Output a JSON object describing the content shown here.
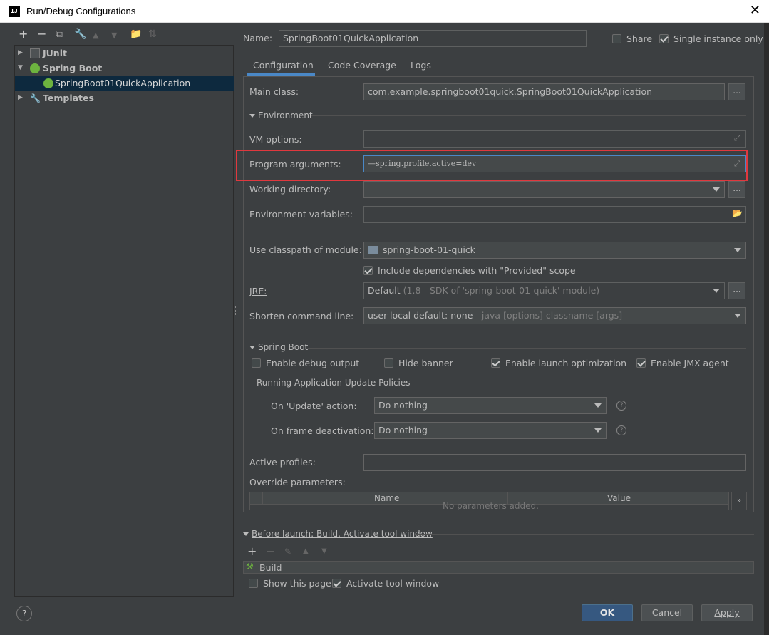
{
  "window": {
    "title": "Run/Debug Configurations",
    "logo": "IJ"
  },
  "tree": {
    "items": [
      {
        "label": "JUnit"
      },
      {
        "label": "Spring Boot"
      },
      {
        "label": "SpringBoot01QuickApplication"
      },
      {
        "label": "Templates"
      }
    ]
  },
  "header": {
    "name_label": "Name:",
    "name_value": "SpringBoot01QuickApplication",
    "share_label": "Share",
    "single_instance_label": "Single instance only"
  },
  "tabs": [
    {
      "label": "Configuration"
    },
    {
      "label": "Code Coverage"
    },
    {
      "label": "Logs"
    }
  ],
  "config": {
    "main_class_label": "Main class:",
    "main_class_value": "com.example.springboot01quick.SpringBoot01QuickApplication",
    "environment_label": "Environment",
    "vm_options_label": "VM options:",
    "program_args_label": "Program arguments:",
    "program_args_value": "—spring.profile.active=dev",
    "working_dir_label": "Working directory:",
    "env_vars_label": "Environment variables:",
    "classpath_label": "Use classpath of module:",
    "classpath_value": "spring-boot-01-quick",
    "include_deps_label": "Include dependencies with \"Provided\" scope",
    "jre_label": "JRE:",
    "jre_value": "Default",
    "jre_hint": "(1.8 - SDK of 'spring-boot-01-quick' module)",
    "shorten_label": "Shorten command line:",
    "shorten_value": "user-local default: none",
    "shorten_hint": "- java [options] classname [args]"
  },
  "spring_boot": {
    "section_label": "Spring Boot",
    "debug_output_label": "Enable debug output",
    "hide_banner_label": "Hide banner",
    "launch_opt_label": "Enable launch optimization",
    "jmx_label": "Enable JMX agent",
    "policies_label": "Running Application Update Policies",
    "on_update_label": "On 'Update' action:",
    "on_update_value": "Do nothing",
    "on_frame_label": "On frame deactivation:",
    "on_frame_value": "Do nothing",
    "active_profiles_label": "Active profiles:",
    "override_label": "Override parameters:",
    "col_name": "Name",
    "col_value": "Value",
    "empty_text": "No parameters added.",
    "more": "»"
  },
  "before_launch": {
    "label": "Before launch: Build, Activate tool window",
    "item": "Build",
    "show_page_label": "Show this page",
    "activate_label": "Activate tool window"
  },
  "buttons": {
    "help": "?",
    "ok": "OK",
    "cancel": "Cancel",
    "apply": "Apply"
  }
}
